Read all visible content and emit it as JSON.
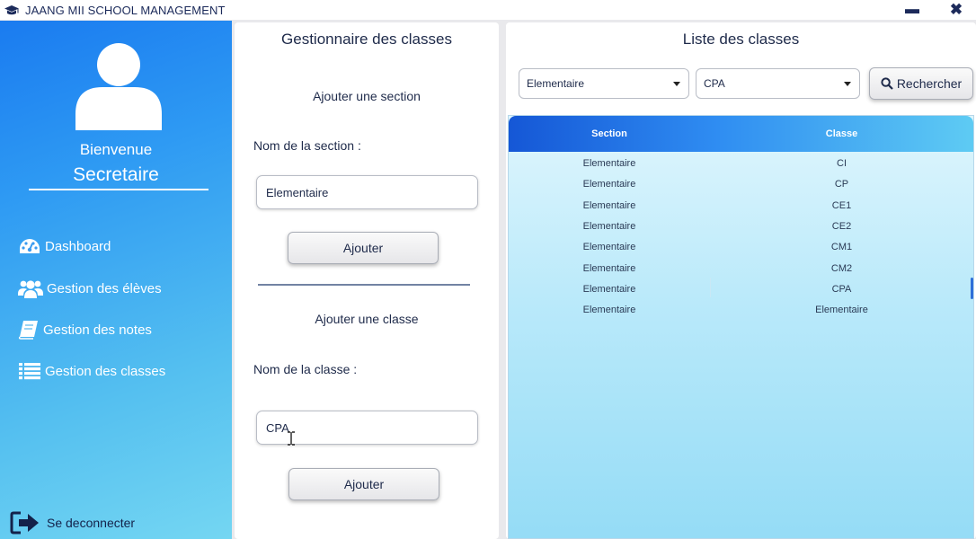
{
  "window": {
    "title": "JAANG MII SCHOOL MANAGEMENT",
    "minimize_label": "▬",
    "close_label": "✖"
  },
  "sidebar": {
    "welcome": "Bienvenue",
    "role": "Secretaire",
    "items": [
      {
        "label": "Dashboard",
        "icon": "dashboard-icon"
      },
      {
        "label": "Gestion des élèves",
        "icon": "users-icon"
      },
      {
        "label": "Gestion des notes",
        "icon": "notebook-icon"
      },
      {
        "label": "Gestion des classes",
        "icon": "list-icon"
      }
    ],
    "logout_label": "Se deconnecter"
  },
  "class_manager": {
    "title": "Gestionnaire des classes",
    "section_subtitle": "Ajouter une section",
    "section_field_label": "Nom de la section  :",
    "section_field_value": "Elementaire",
    "section_add_label": "Ajouter",
    "class_subtitle": "Ajouter une classe",
    "class_field_label": "Nom de la classe :",
    "class_field_value": "CPA",
    "class_add_label": "Ajouter"
  },
  "class_list": {
    "title": "Liste des classes",
    "section_filter": "Elementaire",
    "classe_filter": "CPA",
    "search_label": "Rechercher",
    "columns": [
      "Section",
      "Classe"
    ],
    "rows": [
      [
        "Elementaire",
        "CI"
      ],
      [
        "Elementaire",
        "CP"
      ],
      [
        "Elementaire",
        "CE1"
      ],
      [
        "Elementaire",
        "CE2"
      ],
      [
        "Elementaire",
        "CM1"
      ],
      [
        "Elementaire",
        "CM2"
      ],
      [
        "Elementaire",
        "CPA"
      ],
      [
        "Elementaire",
        "Elementaire"
      ]
    ]
  },
  "colors": {
    "sidebar_top": "#1a7bf0",
    "sidebar_bottom": "#74d6f2",
    "table_header_start": "#1557d6",
    "table_header_end": "#5ecbf3",
    "text_dark": "#1e2a4a"
  }
}
